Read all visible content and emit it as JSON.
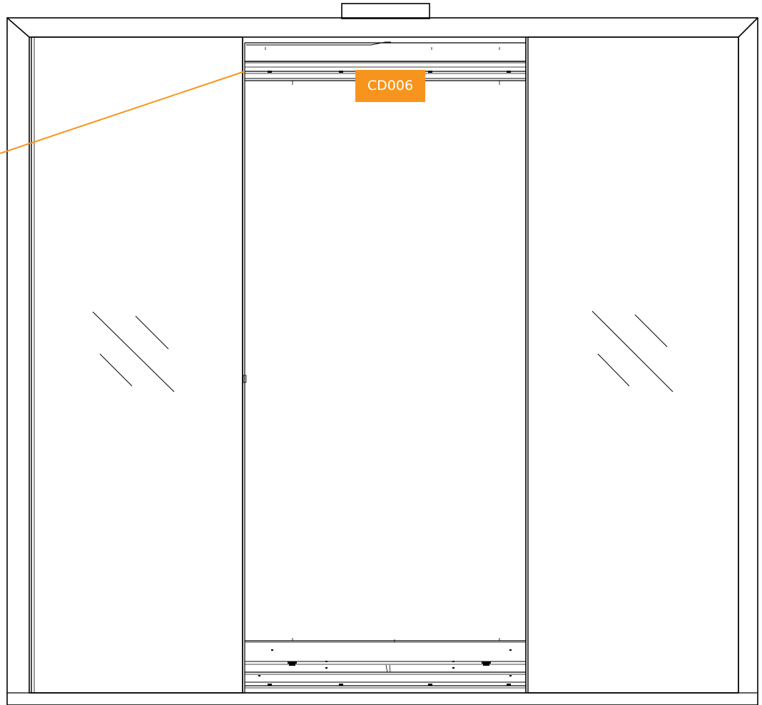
{
  "callout": {
    "label": "CD006",
    "color": "#F7941D",
    "leader_color": "#F7941D"
  },
  "drawing": {
    "line_color": "#000000",
    "background": "#ffffff"
  }
}
